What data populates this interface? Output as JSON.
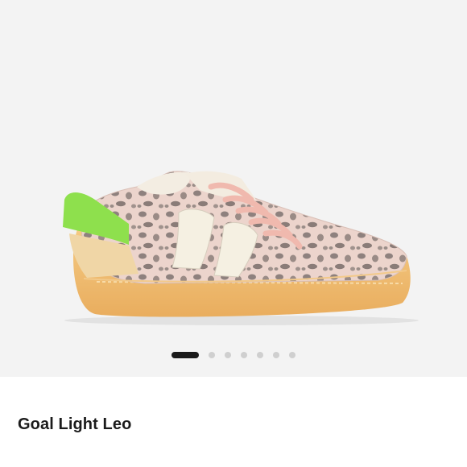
{
  "product": {
    "name": "Goal Light Leo",
    "image_icon": "sneaker-image"
  },
  "carousel": {
    "total_slides": 7,
    "active_index": 0
  },
  "colors": {
    "gallery_bg": "#f3f3f3",
    "dot_active": "#1a1a1a",
    "dot_inactive": "#cfcfcf"
  }
}
